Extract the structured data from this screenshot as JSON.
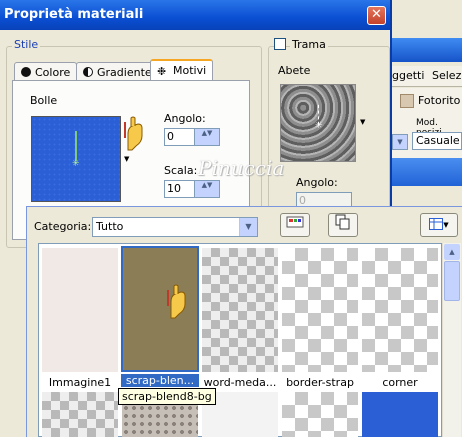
{
  "dialog": {
    "title": "Proprietà materiali",
    "close_glyph": "✕"
  },
  "stile": {
    "label": "Stile",
    "tabs": [
      {
        "label": "Colore",
        "icon": "solid-circle-icon"
      },
      {
        "label": "Gradiente",
        "icon": "half-circle-icon"
      },
      {
        "label": "Motivi",
        "icon": "pattern-icon",
        "active": true
      }
    ],
    "pattern_name": "Bolle",
    "angolo_label": "Angolo:",
    "angolo_value": "0",
    "scala_label": "Scala:",
    "scala_value": "10",
    "preview_color": "#2a5fd6"
  },
  "trama": {
    "checkbox_label": "Trama",
    "checked": false,
    "texture_name": "Abete",
    "angolo_label": "Angolo:",
    "angolo_value": "0"
  },
  "background_app": {
    "menu_items": [
      "ggetti",
      "Selezio"
    ],
    "photo_label": "Fotorito",
    "mode_label": "Mod. posizi",
    "mode_value": "Casuale"
  },
  "watermark": "Pinuccia",
  "picker": {
    "category_label": "Categoria:",
    "category_value": "Tutto",
    "items": [
      {
        "caption": "Immagine1",
        "style": "plain"
      },
      {
        "caption": "scrap-blen...",
        "style": "brown",
        "selected": true
      },
      {
        "caption": "word-meda...",
        "style": "checker"
      },
      {
        "caption": "border-strap",
        "style": "checker"
      },
      {
        "caption": "corner",
        "style": "checker"
      }
    ],
    "tooltip": "scrap-blend8-bg"
  },
  "colors": {
    "title_bar": "#0a4fd3",
    "selection": "#316ac5",
    "accent_tab": "#f5a623"
  }
}
